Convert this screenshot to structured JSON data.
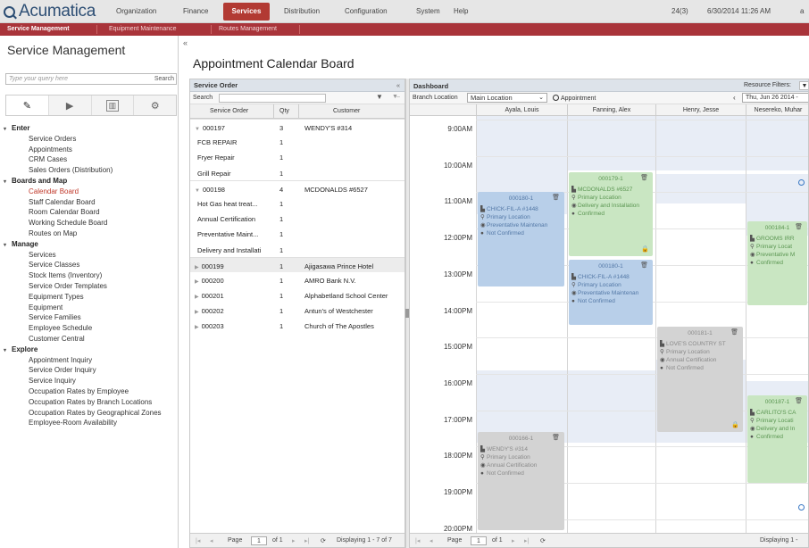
{
  "topbar": {
    "logo_text": "Acumatica",
    "nav": [
      "Organization",
      "Finance",
      "Services",
      "Distribution",
      "Configuration",
      "System",
      "Help"
    ],
    "active": "Services",
    "count": "24(3)",
    "datetime": "6/30/2014 11:26 AM",
    "user_initial": "a"
  },
  "subnav": {
    "items": [
      "Service Management",
      "Equipment Maintenance",
      "Routes Management"
    ],
    "active": "Service Management"
  },
  "leftpanel": {
    "title": "Service Management",
    "search_placeholder": "Type your query here",
    "search_button": "Search",
    "tab_icons": [
      "pencil-icon",
      "play-icon",
      "report-icon",
      "gear-icon"
    ],
    "groups": [
      {
        "label": "Enter",
        "items": [
          "Service Orders",
          "Appointments",
          "CRM Cases",
          "Sales Orders (Distribution)"
        ]
      },
      {
        "label": "Boards and Map",
        "items": [
          "Calendar Board",
          "Staff Calendar Board",
          "Room Calendar Board",
          "Working Schedule Board",
          "Routes on Map"
        ]
      },
      {
        "label": "Manage",
        "items": [
          "Services",
          "Service Classes",
          "Stock Items (Inventory)",
          "Service Order Templates",
          "Equipment Types",
          "Equipment",
          "Service Families",
          "Employee Schedule",
          "Customer Central"
        ]
      },
      {
        "label": "Explore",
        "items": [
          "Appointment Inquiry",
          "Service Order Inquiry",
          "Service Inquiry",
          "Occupation Rates by Employee",
          "Occupation Rates by Branch Locations",
          "Occupation Rates by Geographical Zones",
          "Employee-Room Availability"
        ]
      }
    ],
    "active_item": "Calendar Board"
  },
  "page_title": "Appointment Calendar Board",
  "service_order": {
    "header": "Service Order",
    "search_label": "Search",
    "columns": [
      "Service Order",
      "Qty",
      "Customer"
    ],
    "rows": [
      {
        "order": "000197",
        "qty": "3",
        "customer": "WENDY'S #314",
        "expanded": true
      },
      {
        "order": "FCB REPAIR",
        "qty": "1",
        "customer": ""
      },
      {
        "order": "Fryer Repair",
        "qty": "1",
        "customer": ""
      },
      {
        "order": "Grill Repair",
        "qty": "1",
        "customer": ""
      },
      {
        "order": "000198",
        "qty": "4",
        "customer": "MCDONALDS #6527",
        "expanded": true
      },
      {
        "order": "Hot Gas heat treat...",
        "qty": "1",
        "customer": ""
      },
      {
        "order": "Annual Certification",
        "qty": "1",
        "customer": ""
      },
      {
        "order": "Preventative Maint...",
        "qty": "1",
        "customer": ""
      },
      {
        "order": "Delivery and Installati",
        "qty": "1",
        "customer": ""
      },
      {
        "order": "000199",
        "qty": "1",
        "customer": "Ajigasawa Prince Hotel",
        "collapsed": true
      },
      {
        "order": "000200",
        "qty": "1",
        "customer": "AMRO Bank N.V.",
        "collapsed": true
      },
      {
        "order": "000201",
        "qty": "1",
        "customer": "Alphabetland School Center",
        "collapsed": true
      },
      {
        "order": "000202",
        "qty": "1",
        "customer": "Antun's of Westchester",
        "collapsed": true
      },
      {
        "order": "000203",
        "qty": "1",
        "customer": "Church of The Apostles",
        "collapsed": true
      }
    ],
    "footer": {
      "page_label": "Page",
      "page": "1",
      "of": "of 1",
      "displaying": "Displaying 1 - 7 of 7"
    }
  },
  "dashboard": {
    "header": "Dashboard",
    "resource_filters": "Resource Filters:",
    "branch_label": "Branch Location",
    "branch_value": "Main Location",
    "appointment_label": "Appointment",
    "date_value": "Thu, Jun 26 2014 -",
    "resources": [
      "Ayala, Louis",
      "Fanning, Alex",
      "Henry, Jesse",
      "Nesereko, Muhar"
    ],
    "times": [
      "9:00AM",
      "10:00AM",
      "11:00AM",
      "12:00PM",
      "13:00PM",
      "14:00PM",
      "15:00PM",
      "16:00PM",
      "17:00PM",
      "18:00PM",
      "19:00PM",
      "20:00PM"
    ],
    "appointments": [
      {
        "id": "000180-1",
        "color": "blue",
        "lines": [
          "CHICK-FIL-A #1448",
          "Primary Location",
          "Preventative Maintenan",
          "Not Confirmed"
        ]
      },
      {
        "id": "000179-1",
        "color": "green",
        "lines": [
          "MCDONALDS #6527",
          "Primary Location",
          "Delivery and Installation",
          "Confirmed"
        ]
      },
      {
        "id": "000180-1",
        "color": "blue",
        "lines": [
          "CHICK-FIL-A #1448",
          "Primary Location",
          "Preventative Maintenan",
          "Not Confirmed"
        ]
      },
      {
        "id": "000184-1",
        "color": "green",
        "lines": [
          "GROOMS IRR",
          "Primary Locat",
          "Preventative M",
          "Confirmed"
        ]
      },
      {
        "id": "000181-1",
        "color": "gray",
        "lines": [
          "LOVE'S COUNTRY ST",
          "Primary Location",
          "Annual Certification",
          "Not Confirmed"
        ]
      },
      {
        "id": "000187-1",
        "color": "green",
        "lines": [
          "CARLITO'S CA",
          "Primary Locati",
          "Delivery and In",
          "Confirmed"
        ]
      },
      {
        "id": "000166-1",
        "color": "gray",
        "lines": [
          "WENDY'S #314",
          "Primary Location",
          "Annual Certification",
          "Not Confirmed"
        ]
      }
    ],
    "footer": {
      "page_label": "Page",
      "page": "1",
      "of": "of 1",
      "displaying": "Displaying 1 -"
    }
  },
  "colors": {
    "brand": "#2d4e74",
    "accent": "#b23a33",
    "blue_appt": "#b8cfe9",
    "green_appt": "#c9e6c2",
    "gray_appt": "#d3d3d3"
  }
}
